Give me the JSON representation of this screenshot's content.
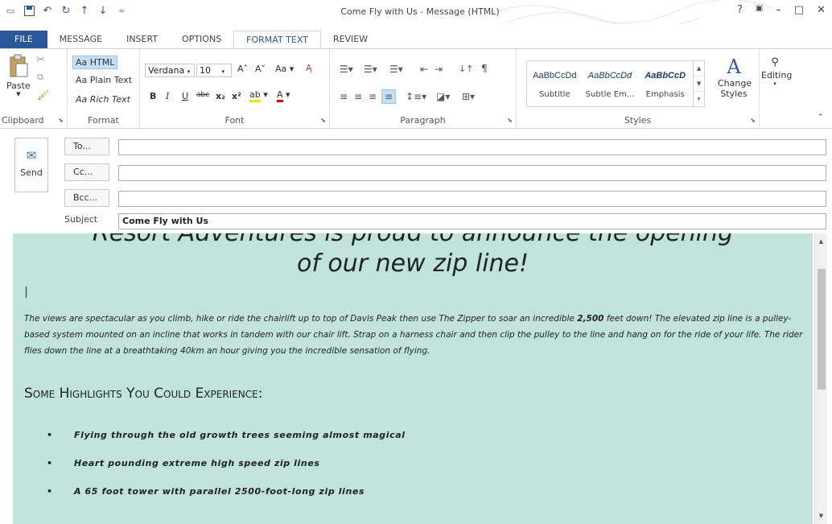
{
  "window": {
    "title": "Come Fly with Us - Message (HTML)",
    "controls": [
      "?",
      "▣",
      "–",
      "□",
      "✕"
    ]
  },
  "qat": [
    "▭",
    "💾",
    "↶",
    "↻",
    "↑",
    "↓",
    "="
  ],
  "tabs": [
    "FILE",
    "MESSAGE",
    "INSERT",
    "OPTIONS",
    "FORMAT TEXT",
    "REVIEW"
  ],
  "ribbon": {
    "clipboard": {
      "paste": "Paste",
      "label": "Clipboard"
    },
    "format": {
      "html": "Aa HTML",
      "plain": "Aa Plain Text",
      "rich": "Aa Rich Text",
      "label": "Format"
    },
    "font": {
      "name": "Verdana",
      "size": "10",
      "label": "Font",
      "bold": "B",
      "italic": "I",
      "underline": "U",
      "strike": "abc",
      "sub": "x₂",
      "sup": "x²",
      "grow": "A˄",
      "shrink": "A˅",
      "case": "Aa"
    },
    "paragraph": {
      "label": "Paragraph"
    },
    "styles": {
      "label": "Styles",
      "items": [
        {
          "preview": "AaBbCcDd",
          "name": "Subtitle"
        },
        {
          "preview": "AaBbCcDd",
          "name": "Subtle Em..."
        },
        {
          "preview": "AaBbCcD",
          "name": "Emphasis"
        }
      ],
      "change": "Change Styles"
    },
    "editing": {
      "label": "Editing"
    }
  },
  "header": {
    "send": "Send",
    "to": "To...",
    "cc": "Cc...",
    "bcc": "Bcc...",
    "subject_label": "Subject",
    "subject": "Come Fly with Us"
  },
  "body": {
    "heading_line1": "Resort Adventures is proud to announce the opening",
    "heading_line2": "of our new zip line!",
    "paragraph_a": "The views are spectacular as you climb, hike or ride the chairlift up to top of Davis Peak then use The Zipper to soar an incredible ",
    "paragraph_bold": "2,500",
    "paragraph_b": " feet down! The elevated zip line is a pulley-based system mounted on an incline that works in tandem with our chair lift.  Strap on a harness chair and then clip the pulley to the line and hang on for the ride of your life. The rider flies down the line at a breathtaking 40km an hour giving you the incredible sensation of flying.",
    "subheading": "Some Highlights You Could Experience:",
    "bullets": [
      "Flying through the old growth trees seeming almost magical",
      "Heart pounding extreme high speed zip lines",
      "A 65 foot tower with parallel 2500-foot-long zip lines"
    ]
  }
}
